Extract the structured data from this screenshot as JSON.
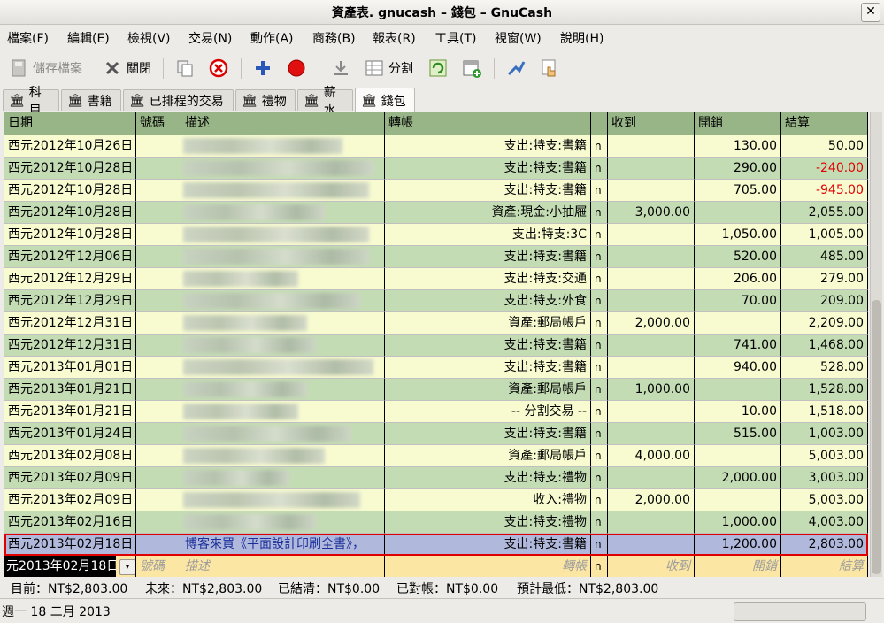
{
  "window": {
    "title": "資產表. gnucash – 錢包  –  GnuCash",
    "close_icon": "✕"
  },
  "menu": [
    "檔案(F)",
    "編輯(E)",
    "檢視(V)",
    "交易(N)",
    "動作(A)",
    "商務(B)",
    "報表(R)",
    "工具(T)",
    "視窗(W)",
    "說明(H)"
  ],
  "toolbar": {
    "save": "儲存檔案",
    "close": "關閉",
    "split": "分割"
  },
  "tabs": [
    "科目",
    "書籍",
    "已排程的交易",
    "禮物",
    "薪水",
    "錢包"
  ],
  "columns": {
    "date": "日期",
    "num": "號碼",
    "desc": "描述",
    "transfer": "轉帳",
    "r": "",
    "deposit": "收到",
    "withdrawal": "開銷",
    "balance": "結算"
  },
  "rows": [
    {
      "date": "西元2012年10月26日",
      "transfer": "支出:特支:書籍",
      "r": "n",
      "deposit": "",
      "withdrawal": "130.00",
      "balance": "50.00",
      "neg": false
    },
    {
      "date": "西元2012年10月28日",
      "transfer": "支出:特支:書籍",
      "r": "n",
      "deposit": "",
      "withdrawal": "290.00",
      "balance": "-240.00",
      "neg": true
    },
    {
      "date": "西元2012年10月28日",
      "transfer": "支出:特支:書籍",
      "r": "n",
      "deposit": "",
      "withdrawal": "705.00",
      "balance": "-945.00",
      "neg": true
    },
    {
      "date": "西元2012年10月28日",
      "transfer": "資產:現金:小抽屜",
      "r": "n",
      "deposit": "3,000.00",
      "withdrawal": "",
      "balance": "2,055.00",
      "neg": false
    },
    {
      "date": "西元2012年10月28日",
      "transfer": "支出:特支:3C",
      "r": "n",
      "deposit": "",
      "withdrawal": "1,050.00",
      "balance": "1,005.00",
      "neg": false
    },
    {
      "date": "西元2012年12月06日",
      "transfer": "支出:特支:書籍",
      "r": "n",
      "deposit": "",
      "withdrawal": "520.00",
      "balance": "485.00",
      "neg": false
    },
    {
      "date": "西元2012年12月29日",
      "transfer": "支出:特支:交通",
      "r": "n",
      "deposit": "",
      "withdrawal": "206.00",
      "balance": "279.00",
      "neg": false
    },
    {
      "date": "西元2012年12月29日",
      "transfer": "支出:特支:外食",
      "r": "n",
      "deposit": "",
      "withdrawal": "70.00",
      "balance": "209.00",
      "neg": false
    },
    {
      "date": "西元2012年12月31日",
      "transfer": "資產:郵局帳戶",
      "r": "n",
      "deposit": "2,000.00",
      "withdrawal": "",
      "balance": "2,209.00",
      "neg": false
    },
    {
      "date": "西元2012年12月31日",
      "transfer": "支出:特支:書籍",
      "r": "n",
      "deposit": "",
      "withdrawal": "741.00",
      "balance": "1,468.00",
      "neg": false
    },
    {
      "date": "西元2013年01月01日",
      "transfer": "支出:特支:書籍",
      "r": "n",
      "deposit": "",
      "withdrawal": "940.00",
      "balance": "528.00",
      "neg": false
    },
    {
      "date": "西元2013年01月21日",
      "transfer": "資產:郵局帳戶",
      "r": "n",
      "deposit": "1,000.00",
      "withdrawal": "",
      "balance": "1,528.00",
      "neg": false
    },
    {
      "date": "西元2013年01月21日",
      "transfer": "-- 分割交易 --",
      "r": "n",
      "deposit": "",
      "withdrawal": "10.00",
      "balance": "1,518.00",
      "neg": false
    },
    {
      "date": "西元2013年01月24日",
      "transfer": "支出:特支:書籍",
      "r": "n",
      "deposit": "",
      "withdrawal": "515.00",
      "balance": "1,003.00",
      "neg": false
    },
    {
      "date": "西元2013年02月08日",
      "transfer": "資產:郵局帳戶",
      "r": "n",
      "deposit": "4,000.00",
      "withdrawal": "",
      "balance": "5,003.00",
      "neg": false
    },
    {
      "date": "西元2013年02月09日",
      "transfer": "支出:特支:禮物",
      "r": "n",
      "deposit": "",
      "withdrawal": "2,000.00",
      "balance": "3,003.00",
      "neg": false
    },
    {
      "date": "西元2013年02月09日",
      "transfer": "收入:禮物",
      "r": "n",
      "deposit": "2,000.00",
      "withdrawal": "",
      "balance": "5,003.00",
      "neg": false
    },
    {
      "date": "西元2013年02月16日",
      "transfer": "支出:特支:禮物",
      "r": "n",
      "deposit": "",
      "withdrawal": "1,000.00",
      "balance": "4,003.00",
      "neg": false
    },
    {
      "date": "西元2013年02月18日",
      "desc": "博客來買《平面設計印刷全書》，",
      "transfer": "支出:特支:書籍",
      "r": "n",
      "deposit": "",
      "withdrawal": "1,200.00",
      "balance": "2,803.00",
      "neg": false
    }
  ],
  "blank_row": {
    "date": "元2013年02月18日",
    "num": "號碼",
    "desc": "描述",
    "transfer": "轉帳",
    "r": "n",
    "deposit": "收到",
    "withdrawal": "開銷",
    "balance": "結算"
  },
  "summary": {
    "present": "目前：NT$2,803.00",
    "future": "未來：NT$2,803.00",
    "cleared": "已結清：NT$0.00",
    "reconciled": "已對帳：NT$0.00",
    "projected_min": "預計最低：NT$2,803.00"
  },
  "status": "週一 18 二月 2013",
  "colors": {
    "header": "#97b586",
    "row_light": "#f8fbd0",
    "row_dark": "#c4dcb4",
    "selected": "#b0b8dc",
    "blank": "#fbe6a4",
    "negative": "#e00000"
  }
}
